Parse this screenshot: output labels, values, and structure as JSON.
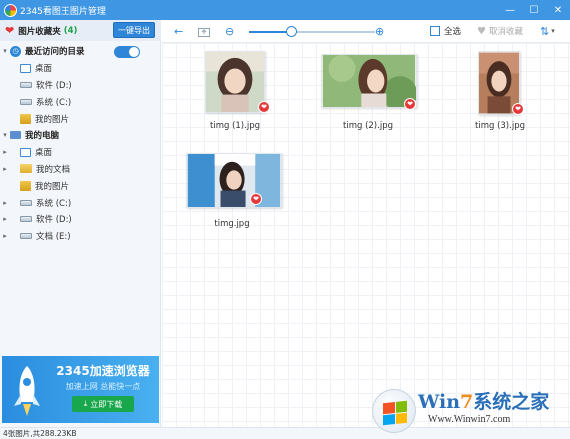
{
  "window": {
    "title": "2345看图王图片管理",
    "min": "—",
    "max": "☐",
    "close": "✕"
  },
  "sidebar": {
    "favorites": {
      "label": "图片收藏夹",
      "count": "(4)",
      "export_label": "一键导出"
    },
    "recent": {
      "label": "最近访问的目录",
      "toggle_on": true,
      "items": [
        {
          "label": "桌面",
          "icon": "desktop-icon"
        },
        {
          "label": "软件 (D:)",
          "icon": "drive-icon"
        },
        {
          "label": "系统 (C:)",
          "icon": "drive-icon"
        },
        {
          "label": "我的图片",
          "icon": "pictures-folder-icon"
        }
      ]
    },
    "computer": {
      "label": "我的电脑",
      "items": [
        {
          "label": "桌面",
          "icon": "desktop-icon",
          "expandable": true
        },
        {
          "label": "我的文档",
          "icon": "documents-folder-icon",
          "expandable": true
        },
        {
          "label": "我的图片",
          "icon": "pictures-folder-icon",
          "expandable": false
        },
        {
          "label": "系统 (C:)",
          "icon": "drive-icon",
          "expandable": true
        },
        {
          "label": "软件 (D:)",
          "icon": "drive-icon",
          "expandable": true
        },
        {
          "label": "文档 (E:)",
          "icon": "drive-icon",
          "expandable": true
        }
      ]
    },
    "ad": {
      "title": "2345加速浏览器",
      "subtitle": "加速上网 总能快一点",
      "button": "立即下载"
    }
  },
  "toolbar": {
    "back": "←",
    "zoom_out": "⊖",
    "zoom_in": "⊕",
    "zoom_level": 0.95,
    "select_all": "全选",
    "unfavorite": "取消收藏",
    "sort": "⇅"
  },
  "images": [
    {
      "name": "timg (1).jpg",
      "favorited": true
    },
    {
      "name": "timg (2).jpg",
      "favorited": true
    },
    {
      "name": "timg (3).jpg",
      "favorited": true
    },
    {
      "name": "timg.jpg",
      "favorited": true
    }
  ],
  "status": {
    "text": "4张图片,共288.23KB"
  },
  "watermark": {
    "title_a": "Win",
    "title_b": "7",
    "title_c": "系统之家",
    "url": "Www.Winwin7.com"
  },
  "colors": {
    "accent": "#2f86d8",
    "titlebar": "#3f97e4",
    "favorite": "#e5383b",
    "download": "#19a74c"
  }
}
